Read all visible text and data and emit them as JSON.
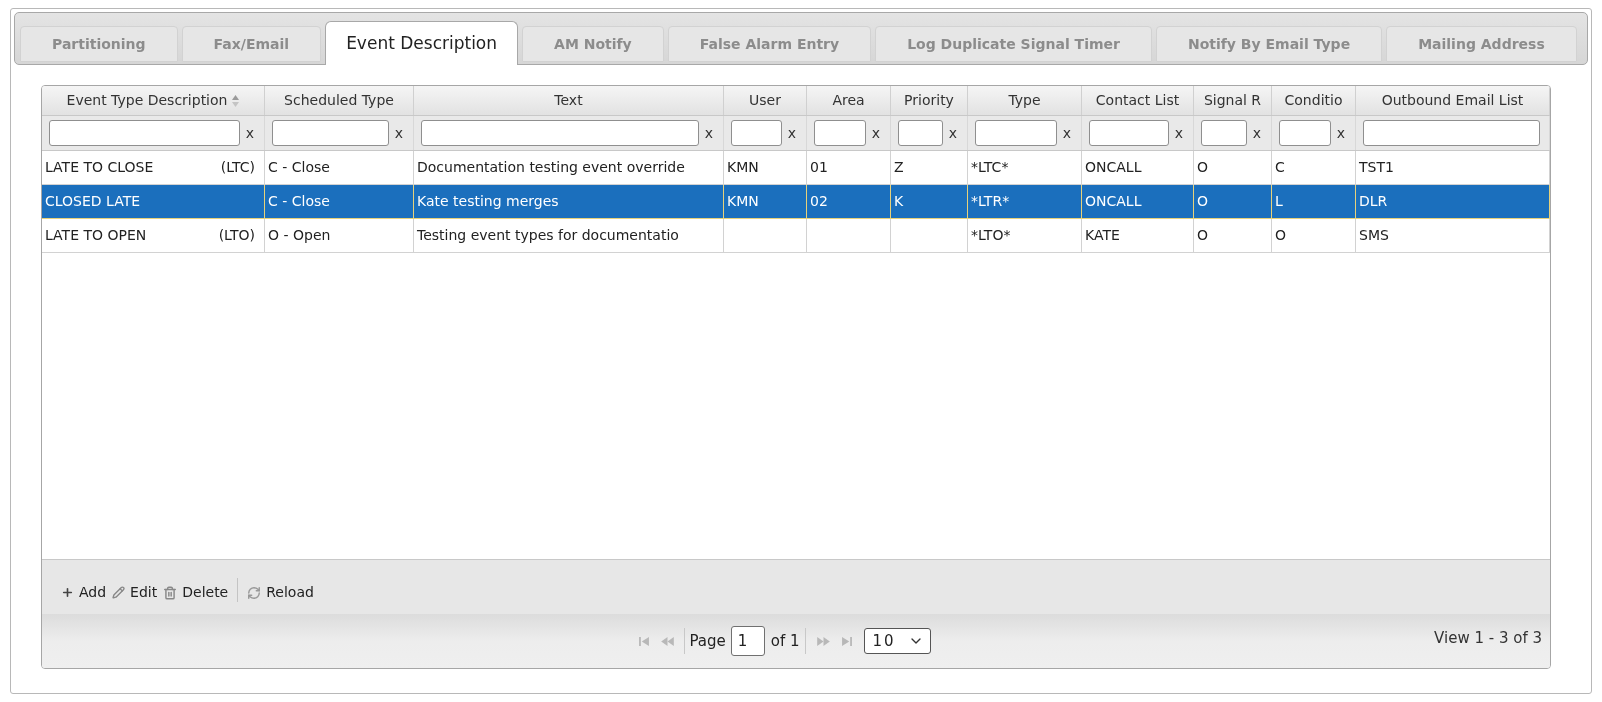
{
  "tabs": [
    {
      "label": "Partitioning",
      "selected": false
    },
    {
      "label": "Fax/Email",
      "selected": false
    },
    {
      "label": "Event Description",
      "selected": true
    },
    {
      "label": "AM Notify",
      "selected": false
    },
    {
      "label": "False Alarm Entry",
      "selected": false
    },
    {
      "label": "Log Duplicate Signal Timer",
      "selected": false
    },
    {
      "label": "Notify By Email Type",
      "selected": false
    },
    {
      "label": "Mailing Address",
      "selected": false
    }
  ],
  "grid": {
    "columns": [
      {
        "label": "Event Type Description",
        "sorted": true,
        "filter_clear": "x"
      },
      {
        "label": "Scheduled Type",
        "sorted": false,
        "filter_clear": "x"
      },
      {
        "label": "Text",
        "sorted": false,
        "filter_clear": "x"
      },
      {
        "label": "User",
        "sorted": false,
        "filter_clear": "x"
      },
      {
        "label": "Area",
        "sorted": false,
        "filter_clear": "x"
      },
      {
        "label": "Priority",
        "sorted": false,
        "filter_clear": "x"
      },
      {
        "label": "Type",
        "sorted": false,
        "filter_clear": "x"
      },
      {
        "label": "Contact List",
        "sorted": false,
        "filter_clear": "x"
      },
      {
        "label": "Signal R",
        "sorted": false,
        "filter_clear": "x"
      },
      {
        "label": "Conditio",
        "sorted": false,
        "filter_clear": "x"
      },
      {
        "label": "Outbound Email List",
        "sorted": false
      }
    ],
    "rows": [
      {
        "selected": false,
        "event_type_description": {
          "name": "LATE TO CLOSE",
          "code": "(LTC)"
        },
        "scheduled_type": "C - Close",
        "text": "Documentation testing event override",
        "user": "KMN",
        "area": "01",
        "priority": "Z",
        "type": "*LTC*",
        "contact_list": "ONCALL",
        "column_9": "O",
        "column_10": "C",
        "outbound_email_list": "TST1"
      },
      {
        "selected": true,
        "event_type_description": {
          "name": "CLOSED LATE"
        },
        "scheduled_type": "C - Close",
        "text": "Kate testing merges",
        "user": "KMN",
        "area": "02",
        "priority": "K",
        "type": "*LTR*",
        "contact_list": "ONCALL",
        "column_9": "O",
        "column_10": "L",
        "outbound_email_list": "DLR"
      },
      {
        "selected": false,
        "event_type_description": {
          "name": "LATE TO OPEN",
          "code": "(LTO)"
        },
        "scheduled_type": "O - Open",
        "text": "Testing event types for documentatio",
        "type": "*LTO*",
        "contact_list": "KATE",
        "column_9": "O",
        "column_10": "O",
        "outbound_email_list": "SMS"
      }
    ],
    "toolbar": [
      {
        "kind": "add",
        "label": "Add"
      },
      {
        "kind": "edit",
        "label": "Edit"
      },
      {
        "kind": "delete",
        "label": "Delete"
      },
      {
        "kind": "reload",
        "label": "Reload"
      }
    ],
    "pager": {
      "nav_back": [
        {
          "kind": "first",
          "disabled": true
        },
        {
          "kind": "prev",
          "disabled": true
        }
      ],
      "page_label": "Page",
      "page": "1",
      "of_label": "of 1",
      "nav_forward": [
        {
          "kind": "next",
          "disabled": true
        },
        {
          "kind": "last",
          "disabled": true
        }
      ],
      "page_size": "10",
      "summary": "View 1 - 3 of 3"
    }
  }
}
